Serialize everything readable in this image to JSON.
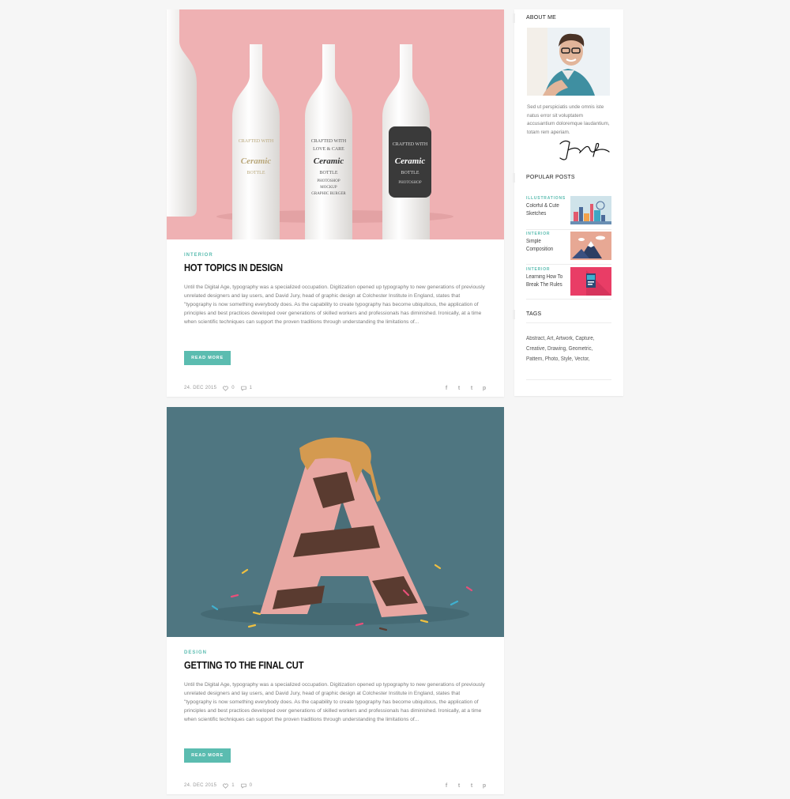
{
  "posts": [
    {
      "category": "INTERIOR",
      "title": "HOT TOPICS IN DESIGN",
      "excerpt": "Until the Digital Age, typography was a specialized occupation. Digitization opened up typography to new generations of previously unrelated designers and lay users, and David Jury, head of graphic design at Colchester Institute in England, states that \"typography is now something everybody does. As the capability to create typography has become ubiquitous, the application of principles and best practices developed over generations of skilled workers and professionals has diminished. Ironically, at a time when scientific techniques can support the proven traditions through understanding the limitations of...",
      "read_more": "READ MORE",
      "date": "24. DEC 2015",
      "likes": "0",
      "comments": "1",
      "image_labels": {
        "line1": "CRAFTED WITH",
        "line2": "LOVE & CARE",
        "brand": "Ceramic",
        "line3": "BOTTLE",
        "line4": "PHOTOSHOP",
        "line5": "MOCKUP",
        "line6": "GRAPHIC BURGER"
      }
    },
    {
      "category": "DESIGN",
      "title": "GETTING TO THE FINAL CUT",
      "excerpt": "Until the Digital Age, typography was a specialized occupation. Digitization opened up typography to new generations of previously unrelated designers and lay users, and David Jury, head of graphic design at Colchester Institute in England, states that \"typography is now something everybody does. As the capability to create typography has become ubiquitous, the application of principles and best practices developed over generations of skilled workers and professionals has diminished. Ironically, at a time when scientific techniques can support the proven traditions through understanding the limitations of...",
      "read_more": "READ MORE",
      "date": "24. DEC 2015",
      "likes": "1",
      "comments": "0"
    }
  ],
  "share_icons": [
    "f",
    "t",
    "t",
    "p"
  ],
  "sidebar": {
    "about_title": "ABOUT ME",
    "about_text": "Sed ut perspiciatis unde omnis iste natus error sit voluptatem accusantium doloremque laudantium, totam rem aperiam.",
    "popular_title": "POPULAR POSTS",
    "popular": [
      {
        "category": "ILLUSTRATIONS",
        "title_line1": "Colorful & Cute",
        "title_line2": "Sketches"
      },
      {
        "category": "INTERIOR",
        "title_line1": "Simple",
        "title_line2": "Composition"
      },
      {
        "category": "INTERIOR",
        "title_line1": "Learning How To",
        "title_line2": "Break The Rules"
      }
    ],
    "tags_title": "TAGS",
    "tags": [
      "Abstract,",
      "Art,",
      "Artwork,",
      "Capture,",
      "Creative,",
      "Drawing,",
      "Geometric,",
      "Pattern,",
      "Photo,",
      "Style,",
      "Vector,"
    ]
  },
  "colors": {
    "accent": "#5bbcb0",
    "background": "#f6f6f6"
  }
}
